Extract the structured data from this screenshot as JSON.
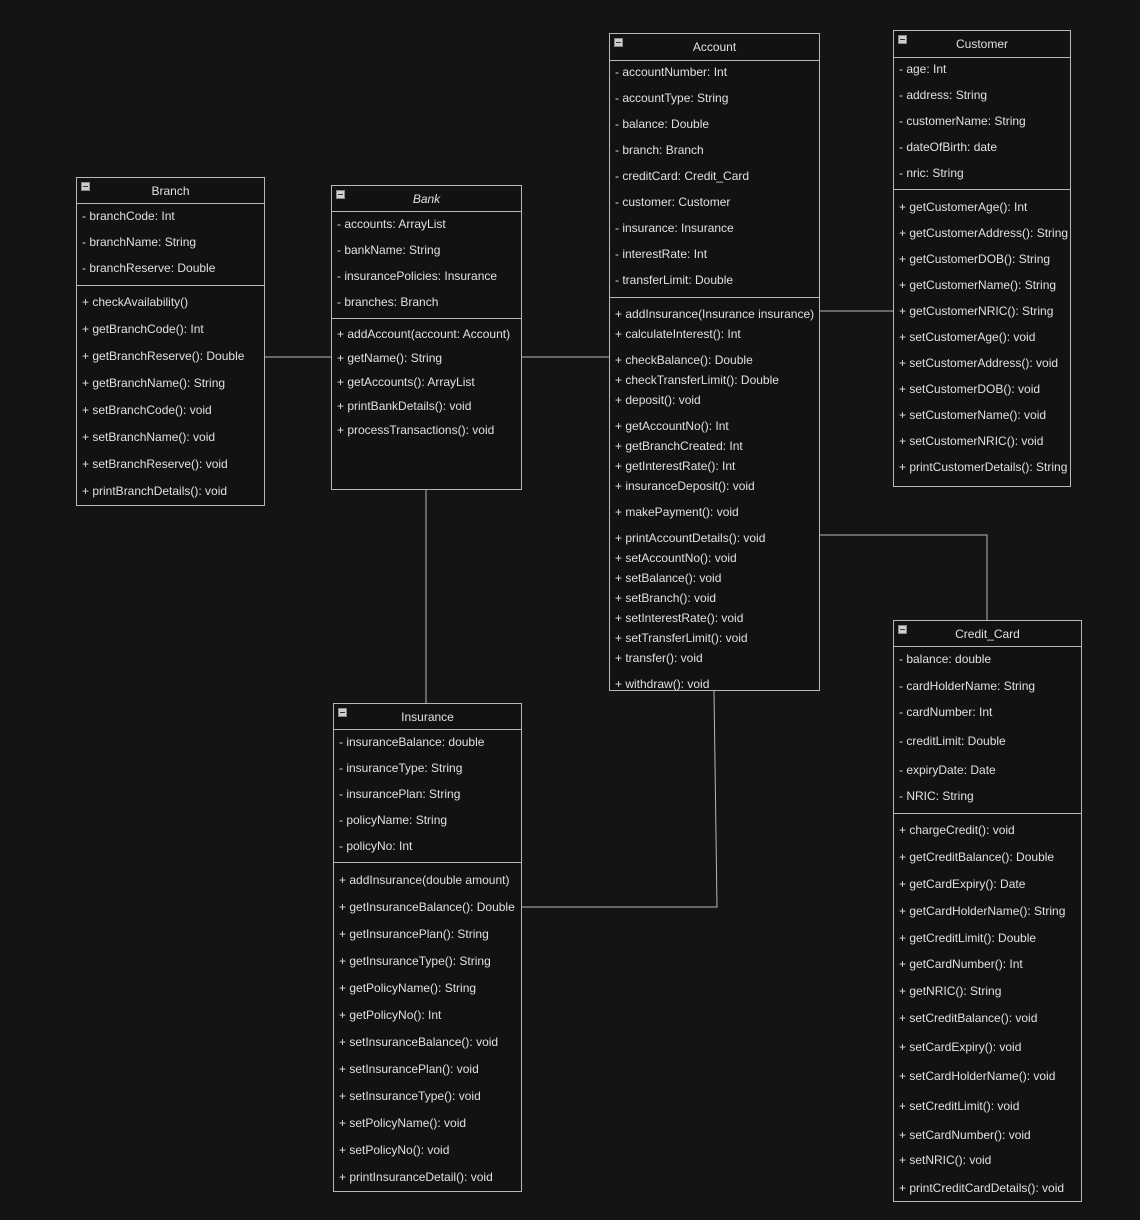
{
  "colors": {
    "background": "#141414",
    "box_fill": "#121212",
    "border": "#b8b8b8",
    "text": "#e0e0e0"
  },
  "classes": [
    {
      "id": "account",
      "name": "Account",
      "italic": false,
      "attributes": [
        "- accountNumber: Int",
        "- accountType: String",
        "- balance: Double",
        "- branch: Branch",
        "- creditCard: Credit_Card",
        "- customer: Customer",
        "- insurance: Insurance",
        "- interestRate: Int",
        "- transferLimit: Double"
      ],
      "methods": [
        "+ addInsurance(Insurance insurance)",
        "+ calculateInterest(): Int",
        "+ checkBalance(): Double",
        "+ checkTransferLimit(): Double",
        "+ deposit(): void",
        "+ getAccountNo(): Int",
        "+ getBranchCreated: Int",
        "+ getInterestRate(): Int",
        "+ insuranceDeposit(): void",
        "+ makePayment(): void",
        "+ printAccountDetails(): void",
        "+ setAccountNo(): void",
        "+ setBalance(): void",
        "+ setBranch(): void",
        "+ setInterestRate(): void",
        "+ setTransferLimit(): void",
        "+ transfer(): void",
        "+ withdraw(): void"
      ]
    },
    {
      "id": "customer",
      "name": "Customer",
      "italic": false,
      "attributes": [
        "- age: Int",
        "- address: String",
        "- customerName: String",
        "- dateOfBirth: date",
        "- nric: String"
      ],
      "methods": [
        "+ getCustomerAge(): Int",
        "+ getCustomerAddress(): String",
        "+ getCustomerDOB(): String",
        "+ getCustomerName(): String",
        "+ getCustomerNRIC(): String",
        "+ setCustomerAge(): void",
        "+ setCustomerAddress(): void",
        "+ setCustomerDOB(): void",
        "+ setCustomerName(): void",
        "+ setCustomerNRIC(): void",
        "+ printCustomerDetails(): String"
      ]
    },
    {
      "id": "branch",
      "name": "Branch",
      "italic": false,
      "attributes": [
        "- branchCode: Int",
        "- branchName: String",
        "- branchReserve: Double"
      ],
      "methods": [
        "+ checkAvailability()",
        "+ getBranchCode(): Int",
        "+ getBranchReserve(): Double",
        "+ getBranchName(): String",
        "+ setBranchCode(): void",
        "+ setBranchName(): void",
        "+ setBranchReserve(): void",
        "+ printBranchDetails(): void"
      ]
    },
    {
      "id": "bank",
      "name": "Bank",
      "italic": true,
      "attributes": [
        "- accounts: ArrayList",
        "- bankName: String",
        "- insurancePolicies: Insurance",
        "- branches: Branch"
      ],
      "methods": [
        "+ addAccount(account: Account)",
        "+ getName(): String",
        "+ getAccounts(): ArrayList",
        "+ printBankDetails(): void",
        "+ processTransactions(): void"
      ]
    },
    {
      "id": "insurance",
      "name": "Insurance",
      "italic": false,
      "attributes": [
        "- insuranceBalance: double",
        "- insuranceType: String",
        "- insurancePlan: String",
        "- policyName: String",
        "- policyNo: Int"
      ],
      "methods": [
        "+ addInsurance(double amount)",
        "+ getInsuranceBalance(): Double",
        "+ getInsurancePlan(): String",
        "+ getInsuranceType(): String",
        "+ getPolicyName(): String",
        "+ getPolicyNo(): Int",
        "+ setInsuranceBalance(): void",
        "+ setInsurancePlan(): void",
        "+ setInsuranceType(): void",
        "+ setPolicyName(): void",
        "+ setPolicyNo(): void",
        "+ printInsuranceDetail(): void"
      ]
    },
    {
      "id": "credit_card",
      "name": "Credit_Card",
      "italic": false,
      "attributes": [
        "- balance: double",
        "- cardHolderName: String",
        "- cardNumber: Int",
        "- creditLimit: Double",
        "- expiryDate: Date",
        "- NRIC: String"
      ],
      "methods": [
        "+ chargeCredit(): void",
        "+ getCreditBalance(): Double",
        "+ getCardExpiry(): Date",
        "+ getCardHolderName(): String",
        "+ getCreditLimit(): Double",
        "+ getCardNumber(): Int",
        "+ getNRIC(): String",
        "+ setCreditBalance(): void",
        "+ setCardExpiry(): void",
        "+ setCardHolderName(): void",
        "+ setCreditLimit(): void",
        "+ setCardNumber(): void",
        "+ setNRIC(): void",
        "+ printCreditCardDetails(): void"
      ]
    }
  ],
  "associations": [
    {
      "from": "branch",
      "to": "bank"
    },
    {
      "from": "bank",
      "to": "account"
    },
    {
      "from": "account",
      "to": "customer"
    },
    {
      "from": "account",
      "to": "credit_card"
    },
    {
      "from": "bank",
      "to": "insurance"
    },
    {
      "from": "account",
      "to": "insurance"
    }
  ]
}
